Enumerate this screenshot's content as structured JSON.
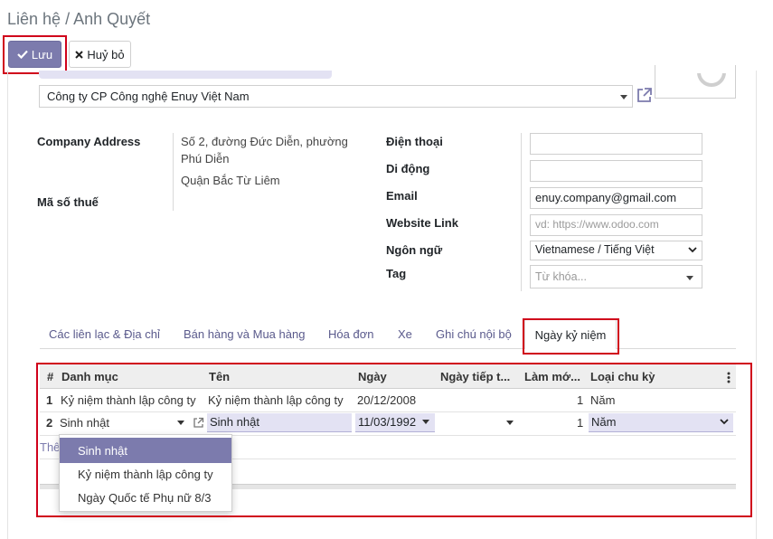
{
  "breadcrumb": {
    "parent": "Liên hệ",
    "separator": " / ",
    "current": "Anh Quyết"
  },
  "actions": {
    "save_label": "Lưu",
    "discard_label": "Huỷ bỏ"
  },
  "company": {
    "value": "Công ty CP Công nghệ Enuy Việt Nam"
  },
  "address": {
    "label": "Company Address",
    "line1": "Số 2, đường Đức Diễn, phường",
    "line2": "Phú Diễn",
    "line3": "Quận Bắc Từ Liêm"
  },
  "tax": {
    "label": "Mã số thuế"
  },
  "contact": {
    "phone_label": "Điện thoại",
    "phone_value": "",
    "mobile_label": "Di động",
    "mobile_value": "",
    "email_label": "Email",
    "email_value": "enuy.company@gmail.com",
    "website_label": "Website Link",
    "website_placeholder": "vd: https://www.odoo.com",
    "language_label": "Ngôn ngữ",
    "language_value": "Vietnamese / Tiếng Việt",
    "tag_label": "Tag",
    "tag_placeholder": "Từ khóa..."
  },
  "tabs": [
    {
      "label": "Các liên lạc & Địa chỉ"
    },
    {
      "label": "Bán hàng và Mua hàng"
    },
    {
      "label": "Hóa đơn"
    },
    {
      "label": "Xe"
    },
    {
      "label": "Ghi chú nội bộ"
    },
    {
      "label": "Ngày kỷ niệm"
    }
  ],
  "table": {
    "columns": [
      "#",
      "Danh mục",
      "Tên",
      "Ngày",
      "Ngày tiếp t...",
      "Làm mớ...",
      "Loại chu kỳ"
    ],
    "rows": [
      {
        "num": "1",
        "category": "Kỷ niệm thành lập công ty",
        "name": "Kỷ niệm thành lập công ty",
        "date": "20/12/2008",
        "next": "",
        "repeat": "1",
        "cycle": "Năm"
      },
      {
        "num": "2",
        "category": "Sinh nhật",
        "name": "Sinh nhật",
        "date": "11/03/1992",
        "next": "",
        "repeat": "1",
        "cycle": "Năm"
      }
    ],
    "add_line_partial": "Thê"
  },
  "dropdown": {
    "options": [
      "Sinh nhật",
      "Kỷ niệm thành lập công ty",
      "Ngày Quốc tế Phụ nữ 8/3"
    ]
  },
  "colors": {
    "accent": "#7c7bad",
    "highlight": "#d0021b",
    "edit_bg": "#e3e2f3"
  }
}
